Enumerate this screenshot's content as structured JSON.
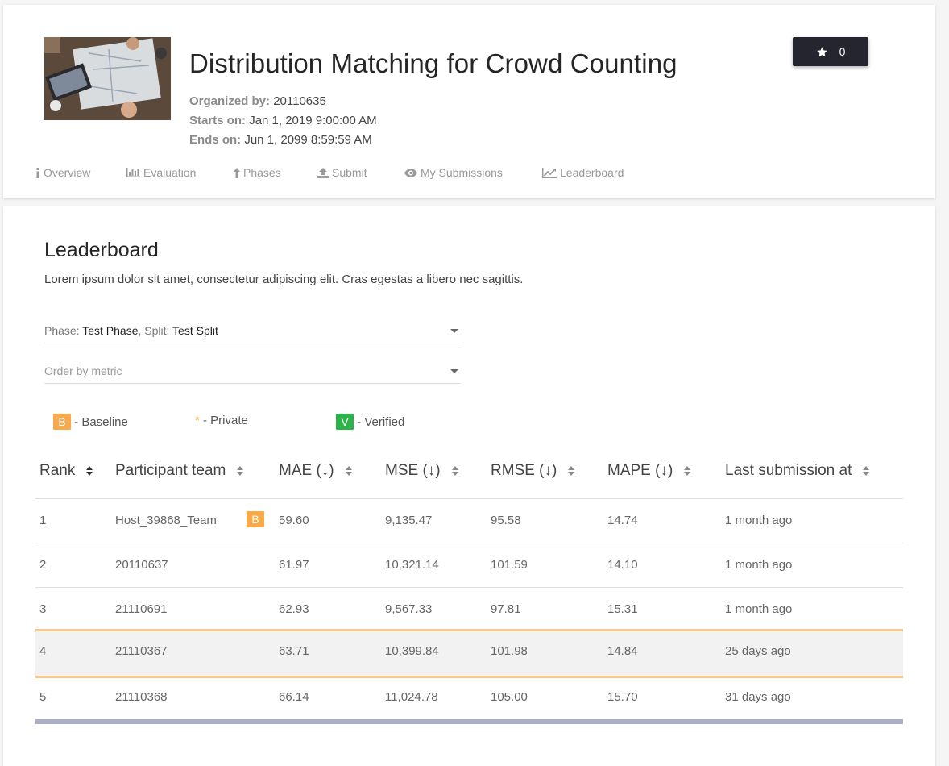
{
  "challenge": {
    "title": "Distribution Matching for Crowd Counting",
    "organized_by_label": "Organized by:",
    "organized_by": "20110635",
    "starts_label": "Starts on:",
    "starts_on": "Jan 1, 2019 9:00:00 AM",
    "ends_label": "Ends on:",
    "ends_on": "Jun 1, 2099 8:59:59 AM",
    "star_count": "0"
  },
  "tabs": [
    {
      "label": "Overview",
      "icon": "info-icon"
    },
    {
      "label": "Evaluation",
      "icon": "bar-chart-icon"
    },
    {
      "label": "Phases",
      "icon": "phase-upload-icon"
    },
    {
      "label": "Submit",
      "icon": "upload-icon"
    },
    {
      "label": "My Submissions",
      "icon": "eye-icon"
    },
    {
      "label": "Leaderboard",
      "icon": "line-chart-icon"
    }
  ],
  "leaderboard": {
    "title": "Leaderboard",
    "description": "Lorem ipsum dolor sit amet, consectetur adipiscing elit. Cras egestas a libero nec sagittis.",
    "phase_select": {
      "phase_label": "Phase: ",
      "phase_value": "Test Phase",
      "split_label": ", Split: ",
      "split_value": "Test Split"
    },
    "order_select": {
      "placeholder": "Order by metric"
    },
    "legend": {
      "baseline_badge": "B",
      "baseline_label": " - Baseline",
      "private_mark": "*",
      "private_label": " - Private",
      "verified_badge": "V",
      "verified_label": " - Verified"
    },
    "columns": [
      "Rank",
      "Participant team",
      "MAE (↓)",
      "MSE (↓)",
      "RMSE (↓)",
      "MAPE (↓)",
      "Last submission at"
    ],
    "rows": [
      {
        "rank": "1",
        "team": "Host_39868_Team",
        "badge": "B",
        "mae": "59.60",
        "mse": "9,135.47",
        "rmse": "95.58",
        "mape": "14.74",
        "last": "1 month ago"
      },
      {
        "rank": "2",
        "team": "20110637",
        "badge": "",
        "mae": "61.97",
        "mse": "10,321.14",
        "rmse": "101.59",
        "mape": "14.10",
        "last": "1 month ago"
      },
      {
        "rank": "3",
        "team": "21110691",
        "badge": "",
        "mae": "62.93",
        "mse": "9,567.33",
        "rmse": "97.81",
        "mape": "15.31",
        "last": "1 month ago"
      },
      {
        "rank": "4",
        "team": "21110367",
        "badge": "",
        "mae": "63.71",
        "mse": "10,399.84",
        "rmse": "101.98",
        "mape": "14.84",
        "last": "25 days ago",
        "highlighted": true
      },
      {
        "rank": "5",
        "team": "21110368",
        "badge": "",
        "mae": "66.14",
        "mse": "11,024.78",
        "rmse": "105.00",
        "mape": "15.70",
        "last": "31 days ago"
      }
    ]
  },
  "colors": {
    "baseline": "#f8a94a",
    "verified": "#2bb34a",
    "highlight_border": "#f7c98a",
    "star_button": "#252530"
  }
}
